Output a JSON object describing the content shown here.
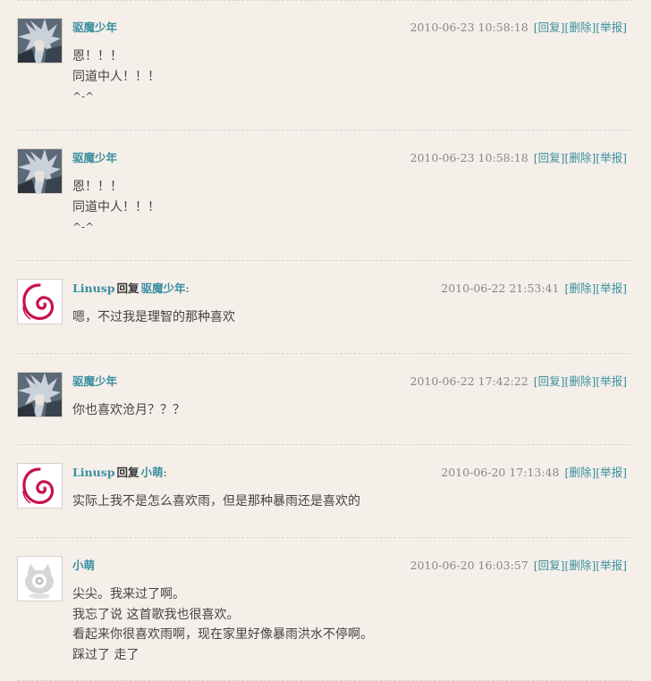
{
  "comments": [
    {
      "user": "驱魔少年",
      "avatar": "anime-avatar",
      "time": "2010-06-23 10:58:18",
      "actions": [
        "[回复]",
        "[删除]",
        "[举报]"
      ],
      "lines": [
        "恩！！！",
        "同道中人！！！",
        "^-^"
      ]
    },
    {
      "user": "驱魔少年",
      "avatar": "anime-avatar",
      "time": "2010-06-23 10:58:18",
      "actions": [
        "[回复]",
        "[删除]",
        "[举报]"
      ],
      "lines": [
        "恩！！！",
        "同道中人！！！",
        "^-^"
      ]
    },
    {
      "user": "Linusp",
      "reply_word": "回复",
      "reply_to": "驱魔少年",
      "colon": ":",
      "avatar": "debian-swirl-avatar",
      "time": "2010-06-22 21:53:41",
      "actions": [
        "[删除]",
        "[举报]"
      ],
      "lines": [
        "嗯，不过我是理智的那种喜欢"
      ]
    },
    {
      "user": "驱魔少年",
      "avatar": "anime-avatar",
      "time": "2010-06-22 17:42:22",
      "actions": [
        "[回复]",
        "[删除]",
        "[举报]"
      ],
      "lines": [
        "你也喜欢沧月？？？"
      ]
    },
    {
      "user": "Linusp",
      "reply_word": "回复",
      "reply_to": "小萌",
      "colon": ":",
      "avatar": "debian-swirl-avatar",
      "time": "2010-06-20 17:13:48",
      "actions": [
        "[删除]",
        "[举报]"
      ],
      "lines": [
        "实际上我不是怎么喜欢雨，但是那种暴雨还是喜欢的"
      ]
    },
    {
      "user": "小萌",
      "avatar": "default-weibo-avatar",
      "time": "2010-06-20 16:03:57",
      "actions": [
        "[回复]",
        "[删除]",
        "[举报]"
      ],
      "lines": [
        "尖尖。我来过了啊。",
        "我忘了说 这首歌我也很喜欢。",
        "看起来你很喜欢雨啊，现在家里好像暴雨洪水不停啊。",
        "踩过了 走了"
      ]
    }
  ],
  "colors": {
    "background": "#f4efe9",
    "link": "#3a8fa0",
    "debian_red": "#c8114c"
  }
}
